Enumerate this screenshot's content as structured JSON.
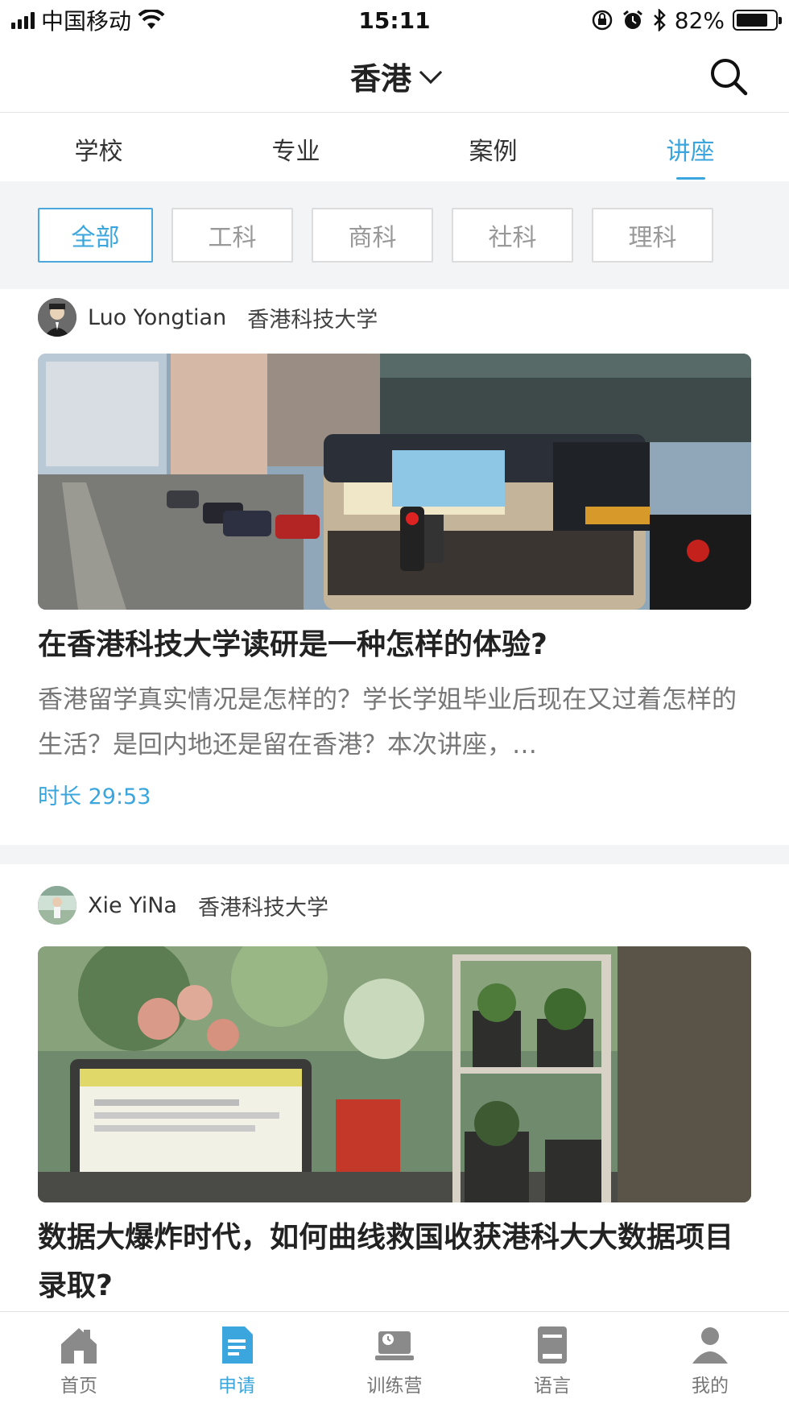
{
  "status_bar": {
    "carrier": "中国移动",
    "time": "15:11",
    "battery": "82%",
    "battery_level": 0.82
  },
  "header": {
    "title": "香港"
  },
  "tabs": [
    {
      "label": "学校",
      "active": false
    },
    {
      "label": "专业",
      "active": false
    },
    {
      "label": "案例",
      "active": false
    },
    {
      "label": "讲座",
      "active": true
    }
  ],
  "filters": [
    {
      "label": "全部",
      "active": true
    },
    {
      "label": "工科",
      "active": false
    },
    {
      "label": "商科",
      "active": false
    },
    {
      "label": "社科",
      "active": false
    },
    {
      "label": "理科",
      "active": false
    }
  ],
  "lectures": [
    {
      "author": "Luo Yongtian",
      "school": "香港科技大学",
      "title": "在香港科技大学读研是一种怎样的体验?",
      "description": "香港留学真实情况是怎样的？学长学姐毕业后现在又过着怎样的生活？是回内地还是留在香港？本次讲座，…",
      "duration": "时长 29:53"
    },
    {
      "author": "Xie YiNa",
      "school": "香港科技大学",
      "title": "数据大爆炸时代，如何曲线救国收获港科大大数据项目录取?"
    }
  ],
  "bottom_nav": [
    {
      "label": "首页",
      "icon": "home-icon",
      "active": false
    },
    {
      "label": "申请",
      "icon": "document-icon",
      "active": true
    },
    {
      "label": "训练营",
      "icon": "camp-icon",
      "active": false
    },
    {
      "label": "语言",
      "icon": "book-icon",
      "active": false
    },
    {
      "label": "我的",
      "icon": "user-icon",
      "active": false
    }
  ],
  "colors": {
    "accent": "#3aa6dd",
    "inactive_icon": "#8a8a8a"
  }
}
